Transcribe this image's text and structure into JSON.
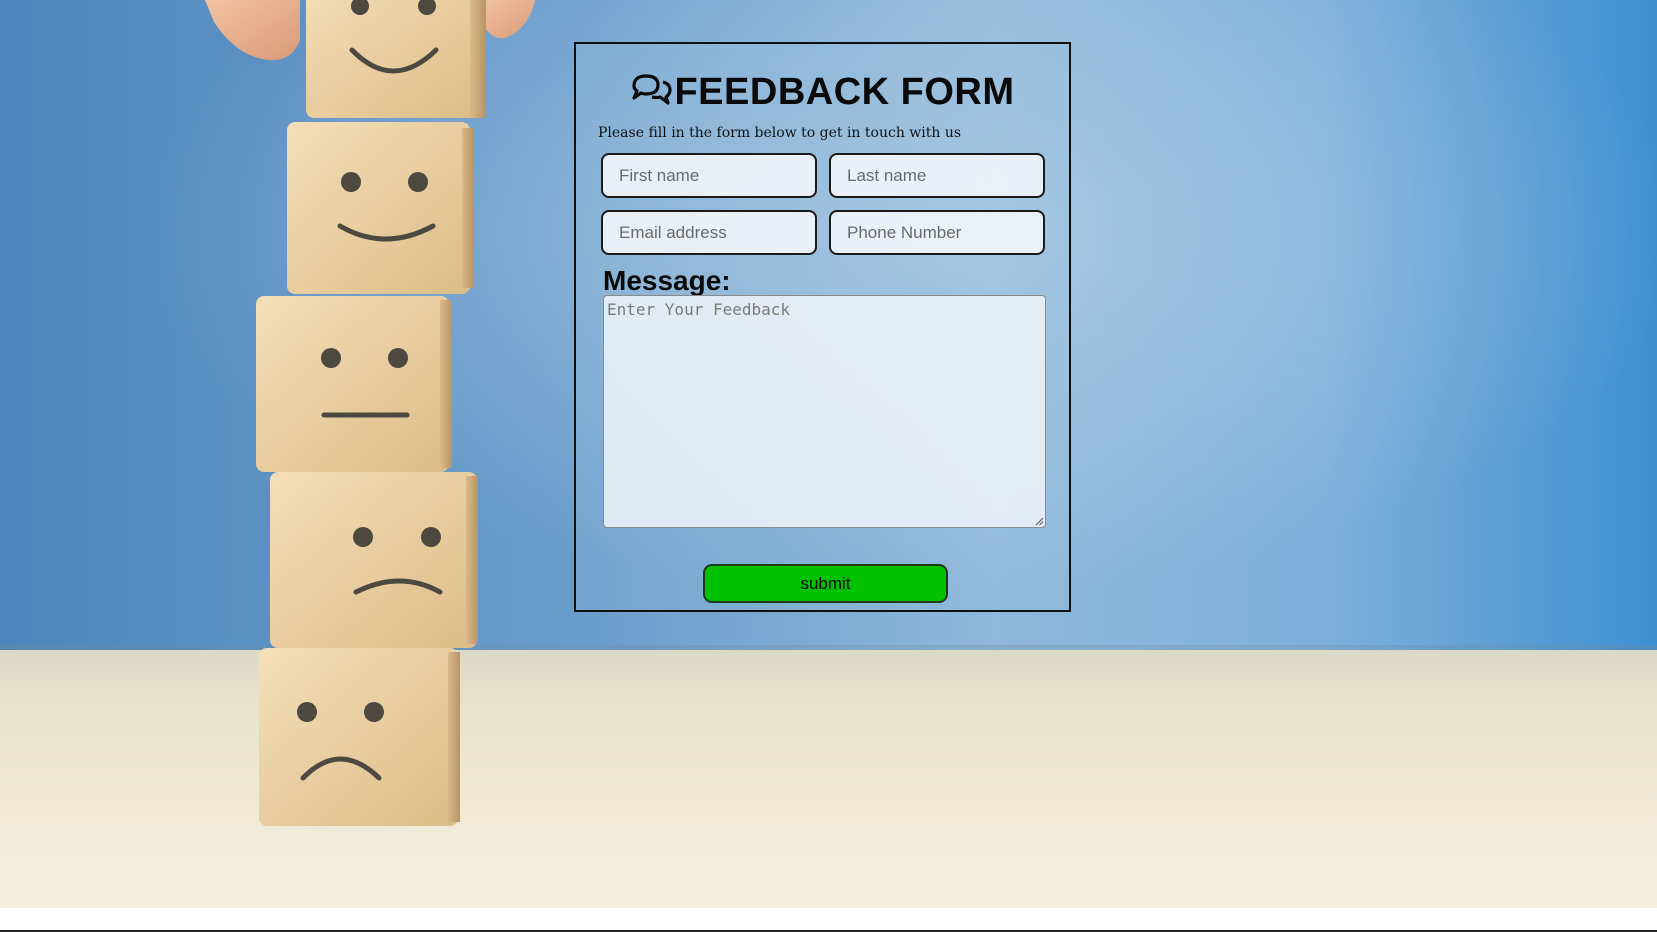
{
  "form": {
    "title": "FEEDBACK FORM",
    "title_icon": "chat-bubbles-icon",
    "subtitle": "Please fill in the form below to get in touch with us",
    "fields": {
      "first_name_placeholder": "First name",
      "last_name_placeholder": "Last name",
      "email_placeholder": "Email address",
      "phone_placeholder": "Phone Number"
    },
    "message_label": "Message:",
    "message_placeholder": "Enter Your Feedback",
    "submit_label": "submit"
  },
  "background": {
    "description_icon": "emoji-blocks-image"
  },
  "colors": {
    "submit_button": "#00c000",
    "border": "#111111",
    "wall_blue": "#6a9ccb",
    "table": "#efe9d6"
  }
}
